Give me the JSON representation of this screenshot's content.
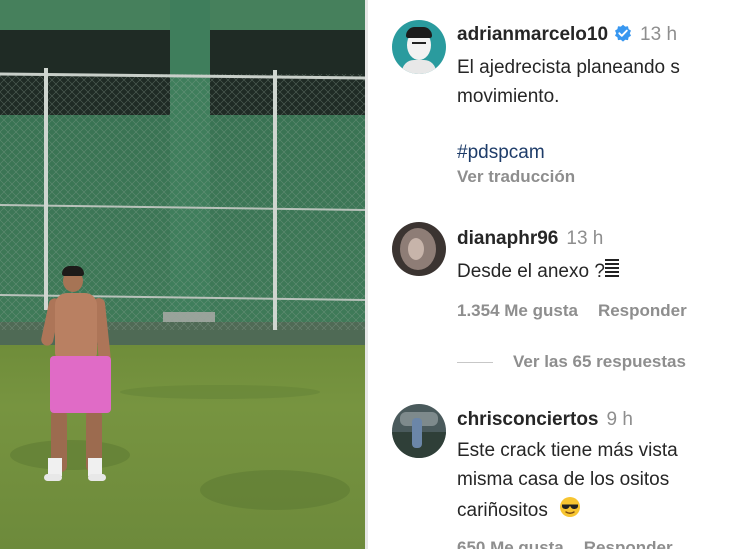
{
  "post": {
    "username": "adrianmarcelo10",
    "time": "13 h",
    "caption_line1": "El ajedrecista planeando s",
    "caption_line2": "movimiento.",
    "hashtag": "#pdspcam",
    "translate": "Ver traducción"
  },
  "comments": [
    {
      "username": "dianaphr96",
      "time": "13 h",
      "text": "Desde el anexo ?",
      "likes": "1.354 Me gusta",
      "reply": "Responder",
      "view_replies": "Ver las 65 respuestas"
    },
    {
      "username": "chrisconciertos",
      "time": "9 h",
      "line1": "Este crack tiene más vista",
      "line2": "misma casa de los ositos",
      "line3": "cariñositos",
      "likes": "650 Me gusta",
      "reply": "Responder"
    }
  ],
  "colors": {
    "verified": "#3897f0",
    "hashtag": "#1e3c69",
    "muted": "#8e8e8e",
    "shorts": "#e06bc6"
  },
  "icons": [
    "verified-badge-icon",
    "ladder-emoji-icon",
    "sunglasses-emoji-icon"
  ]
}
